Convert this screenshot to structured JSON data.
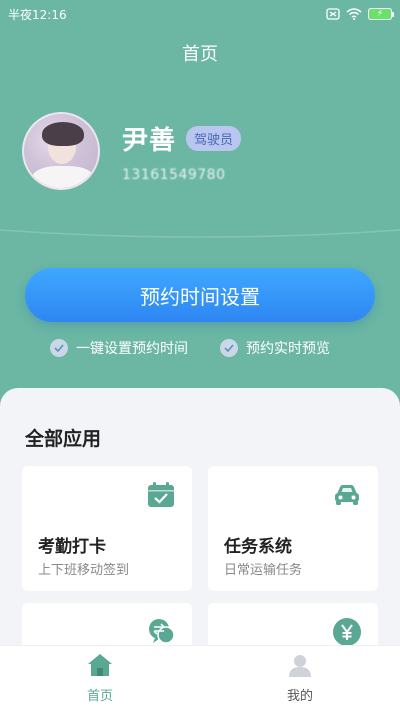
{
  "status_bar": {
    "time": "半夜12:16"
  },
  "header": {
    "title": "首页"
  },
  "profile": {
    "name": "尹善",
    "role": "驾驶员",
    "phone": "13161549780"
  },
  "main_action": {
    "label": "预约时间设置"
  },
  "features": [
    {
      "label": "一键设置预约时间"
    },
    {
      "label": "预约实时预览"
    }
  ],
  "apps_section": {
    "title": "全部应用",
    "cards": [
      {
        "title": "考勤打卡",
        "subtitle": "上下班移动签到",
        "icon": "calendar-check-icon"
      },
      {
        "title": "任务系统",
        "subtitle": "日常运输任务",
        "icon": "car-icon"
      },
      {
        "title": "",
        "subtitle": "",
        "icon": "chat-exchange-icon"
      },
      {
        "title": "",
        "subtitle": "",
        "icon": "yen-icon"
      }
    ]
  },
  "tabbar": {
    "tabs": [
      {
        "label": "首页",
        "icon": "home-icon",
        "active": true
      },
      {
        "label": "我的",
        "icon": "user-icon",
        "active": false
      }
    ]
  },
  "colors": {
    "background": "#6bb7a4",
    "accent": "#5aa894",
    "button": "#2e86f2",
    "badge_bg": "#b9c6ef"
  }
}
